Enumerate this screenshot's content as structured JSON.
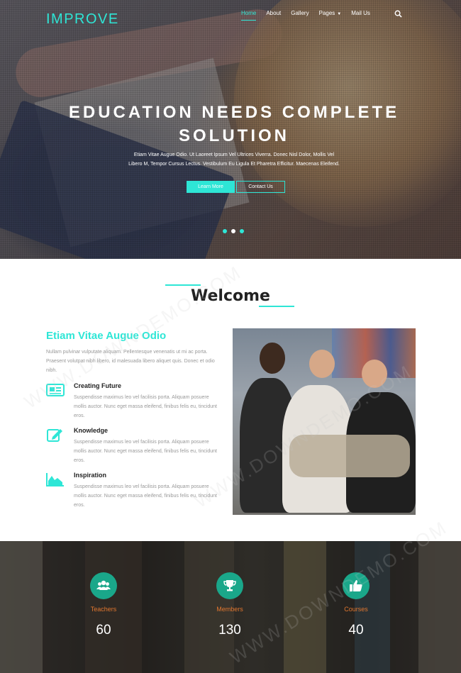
{
  "brand": {
    "logo": "IMPROVE",
    "accent": "#2ee6d6"
  },
  "nav": {
    "items": [
      {
        "label": "Home",
        "active": true
      },
      {
        "label": "About"
      },
      {
        "label": "Gallery"
      },
      {
        "label": "Pages",
        "dropdown": true
      },
      {
        "label": "Mail Us"
      }
    ],
    "search_icon": "search-icon"
  },
  "hero": {
    "title_line1": "EDUCATION NEEDS COMPLETE",
    "title_line2": "SOLUTION",
    "text_line1": "Etiam Vitae Augue Odio. Ut Laoreet Ipsum Vel Ultrices Viverra. Donec Nisl Dolor, Mollis Vel",
    "text_line2": "Libero M, Tempor Cursus Lectus. Vestibulum Eu Ligula Et Pharetra Efficitur. Maecenas Eleifend.",
    "primary_button": "Learn More",
    "secondary_button": "Contact Us",
    "slides": 3,
    "active_slide": 2
  },
  "welcome": {
    "title": "Welcome",
    "subtitle": "Etiam Vitae Augue Odio",
    "paragraph": "Nullam pulvinar vulputate aliquam. Pellentesque venenatis ut mi ac porta. Praesent volutpat nibh libero, id malesuada libero aliquet quis. Donec et odio nibh.",
    "features": [
      {
        "icon": "newspaper-icon",
        "title": "Creating Future",
        "text": "Suspendisse maximus leo vel facilisis porta. Aliquam posuere mollis auctor. Nunc eget massa eleifend, finibus felis eu, tincidunt eros."
      },
      {
        "icon": "edit-icon",
        "title": "Knowledge",
        "text": "Suspendisse maximus leo vel facilisis porta. Aliquam posuere mollis auctor. Nunc eget massa eleifend, finibus felis eu, tincidunt eros."
      },
      {
        "icon": "area-chart-icon",
        "title": "Inspiration",
        "text": "Suspendisse maximus leo vel facilisis porta. Aliquam posuere mollis auctor. Nunc eget massa eleifend, finibus felis eu, tincidunt eros."
      }
    ]
  },
  "stats": [
    {
      "icon": "users-icon",
      "label": "Teachers",
      "value": "60"
    },
    {
      "icon": "trophy-icon",
      "label": "Members",
      "value": "130"
    },
    {
      "icon": "thumbs-up-icon",
      "label": "Courses",
      "value": "40"
    }
  ],
  "colors": {
    "stat_circle": "#1aa78a",
    "stat_label": "#e0762f"
  },
  "watermark": "WWW.DOWNDEMO.COM"
}
